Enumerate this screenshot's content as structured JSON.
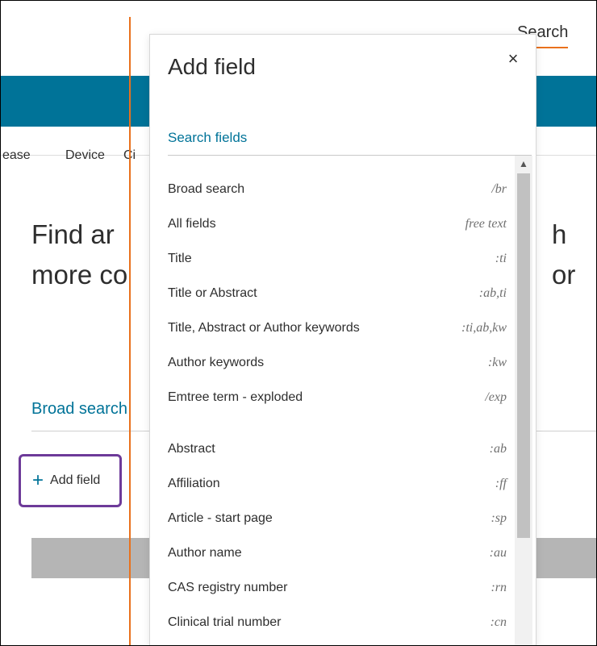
{
  "background": {
    "search_link": "Search",
    "nav_items": [
      "ease",
      "Device",
      "Ci"
    ],
    "heading_line1": "Find ar",
    "heading_line2": "more co",
    "heading_right": "h or",
    "broad_search_label": "Broad search",
    "add_field_label": "Add field",
    "add_field_icon": "plus-icon"
  },
  "panel": {
    "title": "Add field",
    "close_icon": "×",
    "search_fields_label": "Search fields",
    "fields": [
      {
        "label": "Broad search",
        "code": "/br"
      },
      {
        "label": "All fields",
        "code": "free text"
      },
      {
        "label": "Title",
        "code": ":ti"
      },
      {
        "label": "Title or Abstract",
        "code": ":ab,ti"
      },
      {
        "label": "Title, Abstract or Author keywords",
        "code": ":ti,ab,kw"
      },
      {
        "label": "Author keywords",
        "code": ":kw"
      },
      {
        "label": "Emtree term - exploded",
        "code": "/exp"
      },
      {
        "label": "Abstract",
        "code": ":ab"
      },
      {
        "label": "Affiliation",
        "code": ":ff"
      },
      {
        "label": "Article - start page",
        "code": ":sp"
      },
      {
        "label": "Author name",
        "code": ":au"
      },
      {
        "label": "CAS registry number",
        "code": ":rn"
      },
      {
        "label": "Clinical trial number",
        "code": ":cn"
      }
    ]
  },
  "colors": {
    "accent": "#007398",
    "orange": "#e9711c",
    "highlight": "#6d3a99"
  }
}
